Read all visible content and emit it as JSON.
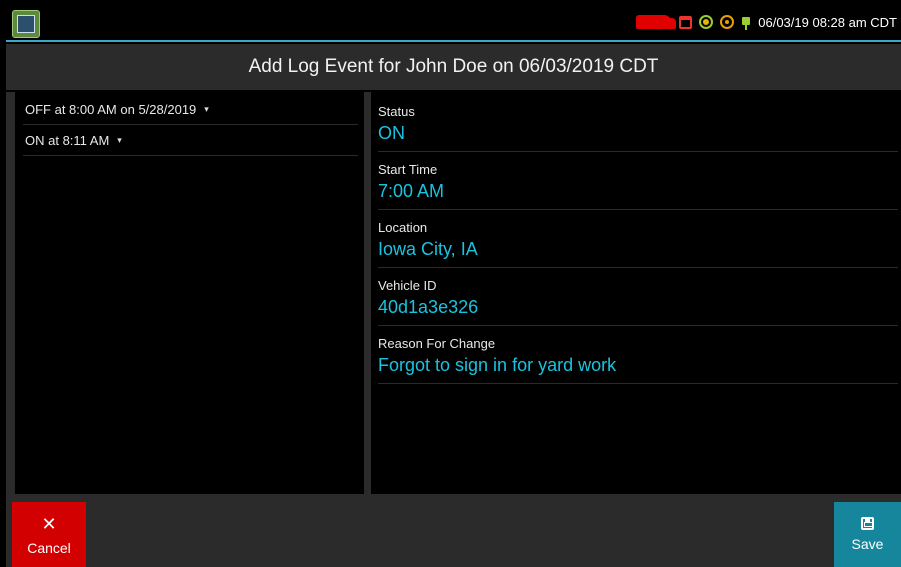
{
  "status_bar": {
    "clock": "06/03/19 08:28 am CDT",
    "icons": [
      "app-icon",
      "truck-icon",
      "calendar-icon",
      "gps-icon",
      "cellular-icon",
      "power-plug-icon"
    ],
    "colors": {
      "truck": "#e00000",
      "accent": "#3aa8c8"
    }
  },
  "header": {
    "title": "Add Log Event for John Doe on 06/03/2019 CDT"
  },
  "log_list": {
    "items": [
      {
        "label": "OFF at 8:00 AM on 5/28/2019",
        "caret": "▾"
      },
      {
        "label": "ON at 8:11 AM",
        "caret": "▾"
      }
    ]
  },
  "detail": {
    "fields": [
      {
        "label": "Status",
        "value": "ON"
      },
      {
        "label": "Start Time",
        "value": "7:00 AM"
      },
      {
        "label": "Location",
        "value": "Iowa City, IA"
      },
      {
        "label": "Vehicle ID",
        "value": "40d1a3e326"
      },
      {
        "label": "Reason For Change",
        "value": "Forgot to sign in for yard work"
      }
    ],
    "value_color": "#19c3e0"
  },
  "footer": {
    "cancel_icon": "✕",
    "cancel_label": "Cancel",
    "save_label": "Save",
    "colors": {
      "cancel": "#d20000",
      "save": "#15869c"
    }
  }
}
